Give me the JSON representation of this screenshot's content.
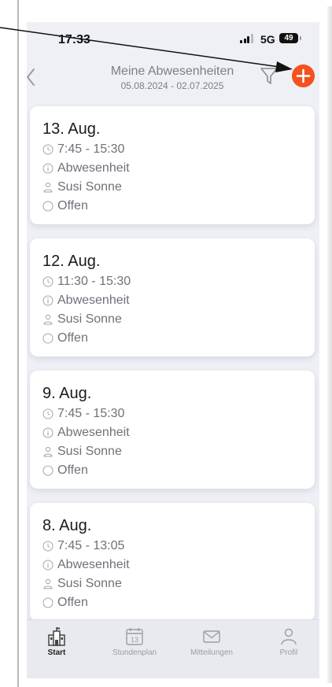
{
  "status_bar": {
    "time": "17:33",
    "network": "5G",
    "battery": "49"
  },
  "header": {
    "title": "Meine Abwesenheiten",
    "date_range": "05.08.2024 - 02.07.2025",
    "back_icon": "chevron-left-icon",
    "filter_icon": "filter-icon",
    "add_icon": "plus-icon",
    "accent_color": "#f4511e"
  },
  "absences": [
    {
      "date": "13. Aug.",
      "time": "7:45 - 15:30",
      "type": "Abwesenheit",
      "person": "Susi Sonne",
      "status": "Offen"
    },
    {
      "date": "12. Aug.",
      "time": "11:30 - 15:30",
      "type": "Abwesenheit",
      "person": "Susi Sonne",
      "status": "Offen"
    },
    {
      "date": "9. Aug.",
      "time": "7:45 - 15:30",
      "type": "Abwesenheit",
      "person": "Susi Sonne",
      "status": "Offen"
    },
    {
      "date": "8. Aug.",
      "time": "7:45 - 13:05",
      "type": "Abwesenheit",
      "person": "Susi Sonne",
      "status": "Offen"
    }
  ],
  "tab_bar": {
    "tabs": [
      {
        "label": "Start",
        "icon": "school-icon",
        "active": true
      },
      {
        "label": "Stundenplan",
        "icon": "calendar-icon",
        "calendar_day": "13",
        "active": false
      },
      {
        "label": "Mitteilungen",
        "icon": "mail-icon",
        "active": false
      },
      {
        "label": "Profil",
        "icon": "person-icon",
        "active": false
      }
    ]
  }
}
